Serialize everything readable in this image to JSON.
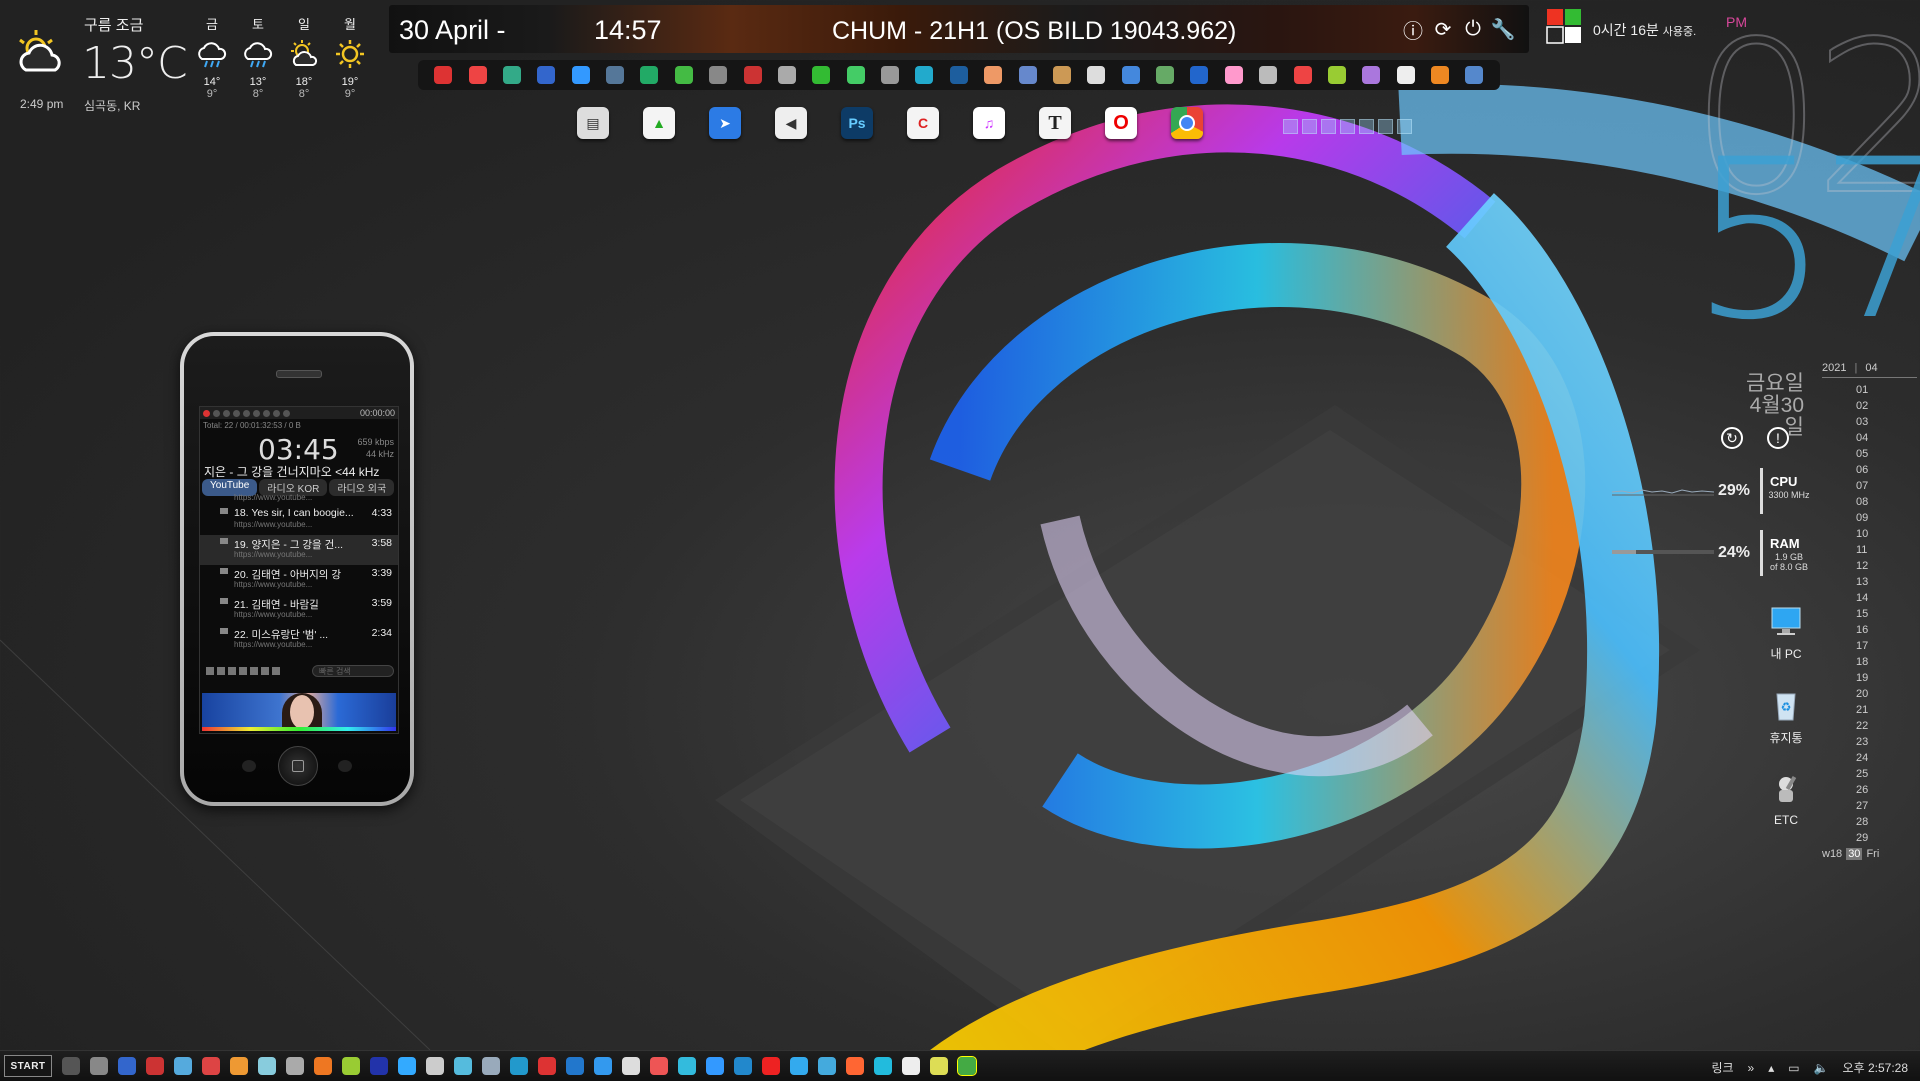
{
  "weather": {
    "condition": "구름 조금",
    "temperature": "13°C",
    "time": "2:49 pm",
    "location": "심곡동, KR",
    "forecast": [
      {
        "day": "금",
        "hi": "14°",
        "lo": "9°",
        "icon": "rain-cloud-icon"
      },
      {
        "day": "토",
        "hi": "13°",
        "lo": "8°",
        "icon": "rain-cloud-icon"
      },
      {
        "day": "일",
        "hi": "18°",
        "lo": "8°",
        "icon": "partly-sunny-icon"
      },
      {
        "day": "월",
        "hi": "19°",
        "lo": "9°",
        "icon": "sun-icon"
      }
    ]
  },
  "topbar": {
    "date": "30 April -",
    "time": "14:57",
    "title": "CHUM - 21H1 (OS BILD 19043.962)"
  },
  "usage": {
    "text": "0시간 16분",
    "suffix": "사용중.",
    "ampm": "PM"
  },
  "clock": {
    "hour": "02",
    "minute": "57"
  },
  "korean_date": {
    "weekday": "금요일",
    "date": "4월30일"
  },
  "calendar": {
    "year": "2021",
    "month": "04",
    "days": [
      "01",
      "02",
      "03",
      "04",
      "05",
      "06",
      "07",
      "08",
      "09",
      "10",
      "11",
      "12",
      "13",
      "14",
      "15",
      "16",
      "17",
      "18",
      "19",
      "20",
      "21",
      "22",
      "23",
      "24",
      "25",
      "26",
      "27",
      "28",
      "29"
    ],
    "week": "w18",
    "today": "30",
    "today_name": "Fri"
  },
  "system": {
    "cpu": {
      "percent": "29%",
      "label": "CPU",
      "sub": "3300 MHz"
    },
    "ram": {
      "percent": "24%",
      "label": "RAM",
      "sub1": "1.9 GB",
      "sub2": "of 8.0 GB"
    }
  },
  "desktop_icons": [
    {
      "label": "내 PC",
      "icon": "computer-icon"
    },
    {
      "label": "휴지통",
      "icon": "recycle-bin-icon"
    },
    {
      "label": "ETC",
      "icon": "etc-tools-icon"
    }
  ],
  "player": {
    "top_time": "00:00:00",
    "total_label": "Total:",
    "total_count": "22",
    "total_time": "00:01:32:53",
    "total_size": "0 B",
    "big_time": "03:45",
    "kbps": "659 kbps",
    "khz": "44 kHz",
    "now_playing": "지은 - 그 강을 건너지마오 <44 kHz",
    "tabs": [
      "YouTube",
      "라디오 KOR",
      "라디오 외국"
    ],
    "first_url": "https://www.youtube...",
    "playlist": [
      {
        "title": "18. Yes sir, I can boogie...",
        "duration": "4:33",
        "url": "https://www.youtube..."
      },
      {
        "title": "19. 양지은 - 그 강을 건...",
        "duration": "3:58",
        "url": "https://www.youtube..."
      },
      {
        "title": "20. 김태연 - 아버지의 강",
        "duration": "3:39",
        "url": "https://www.youtube..."
      },
      {
        "title": "21. 김태연 - 바람길",
        "duration": "3:59",
        "url": "https://www.youtube..."
      },
      {
        "title": "22. 미스유랑단 '범' ...",
        "duration": "2:34",
        "url": "https://www.youtube..."
      }
    ],
    "search_placeholder": "빠른 검색"
  },
  "taskbar": {
    "start": "START",
    "links": "링크",
    "clock": "오후 2:57:28"
  },
  "colors": {
    "accent_blue": "#3ca0d2",
    "pm_pink": "#d7479a"
  }
}
